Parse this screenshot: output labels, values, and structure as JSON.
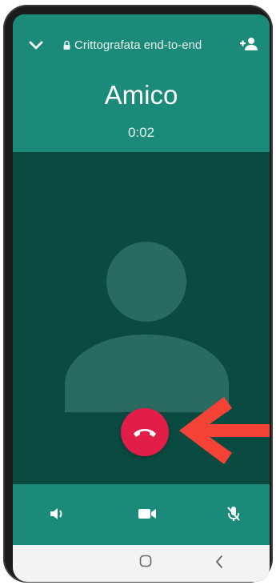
{
  "header": {
    "encryption_label": "Crittografata end-to-end",
    "contact_name": "Amico",
    "call_duration": "0:02"
  },
  "icons": {
    "collapse": "chevron-down-icon",
    "lock": "lock-icon",
    "add_participant": "add-person-icon",
    "avatar": "default-avatar",
    "end_call": "phone-hangup-icon",
    "speaker": "speaker-icon",
    "video": "video-camera-icon",
    "mute": "mic-off-icon",
    "nav_home": "home-button-icon",
    "nav_back": "back-chevron-icon"
  },
  "colors": {
    "header": "#1b8a78",
    "body": "#0a4a41",
    "end_call": "#e11d48",
    "annotation_arrow": "#f44336"
  }
}
